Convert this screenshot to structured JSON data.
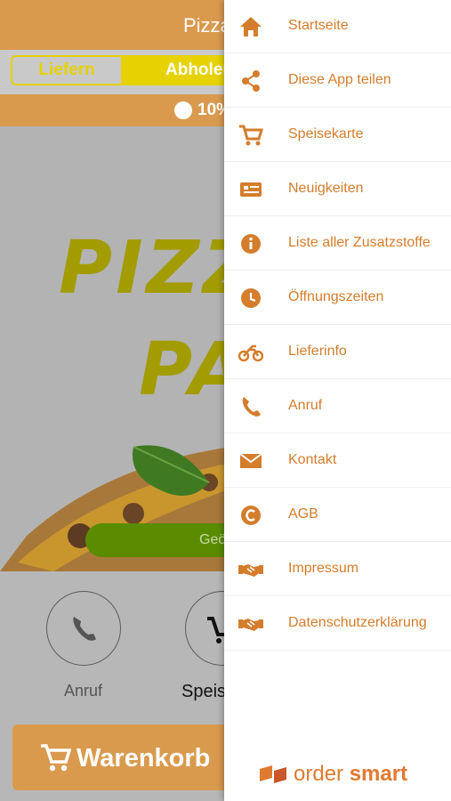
{
  "header": {
    "title": "Pizza"
  },
  "mode_toggle": {
    "deliver": "Liefern",
    "pickup": "Abholen"
  },
  "promo": {
    "text": "10%"
  },
  "hero": {
    "logo_line1": "PIZZ",
    "logo_line2": "PA",
    "open_status": "Geö"
  },
  "actions": {
    "call_label": "Anruf",
    "menu_label": "Speis"
  },
  "cart": {
    "label": "Warenkorb"
  },
  "drawer": {
    "items": [
      {
        "label": "Startseite",
        "icon": "home-icon"
      },
      {
        "label": "Diese App teilen",
        "icon": "share-icon"
      },
      {
        "label": "Speisekarte",
        "icon": "cart-icon"
      },
      {
        "label": "Neuigkeiten",
        "icon": "news-icon"
      },
      {
        "label": "Liste aller Zusatzstoffe",
        "icon": "info-icon"
      },
      {
        "label": "Öffnungszeiten",
        "icon": "clock-icon"
      },
      {
        "label": "Lieferinfo",
        "icon": "motorbike-icon"
      },
      {
        "label": "Anruf",
        "icon": "phone-icon"
      },
      {
        "label": "Kontakt",
        "icon": "mail-icon"
      },
      {
        "label": "AGB",
        "icon": "copyright-icon"
      },
      {
        "label": "Impressum",
        "icon": "handshake-icon"
      },
      {
        "label": "Datenschutzerklärung",
        "icon": "handshake-icon"
      }
    ],
    "brand": {
      "part1": "order ",
      "part2": "smart"
    }
  },
  "colors": {
    "accent": "#d99a4e",
    "drawer_text": "#d47d2c",
    "toggle_yellow": "#e6d200",
    "open_green": "#5a8c00"
  }
}
